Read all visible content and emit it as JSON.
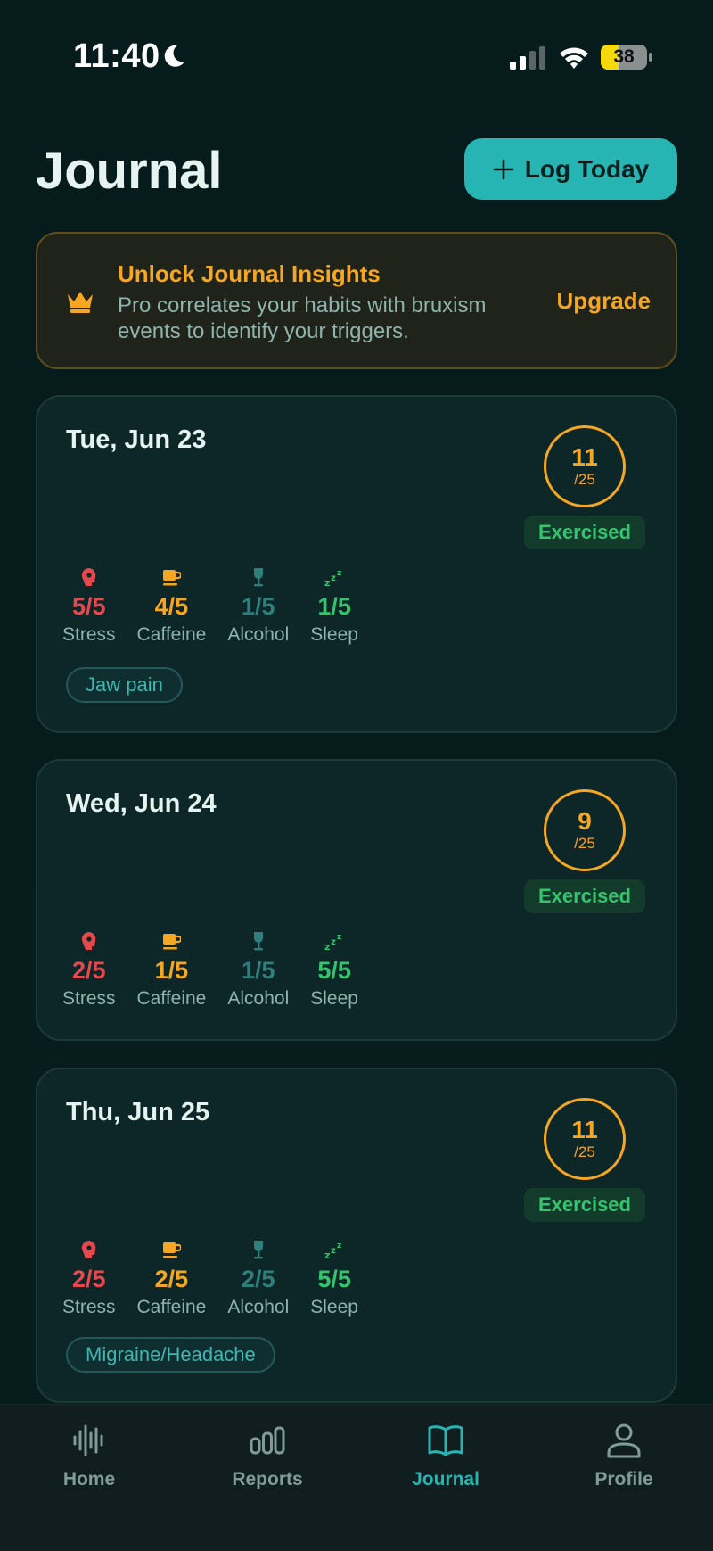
{
  "status_bar": {
    "time": "11:40",
    "battery_level": 38,
    "battery_text": "38"
  },
  "header": {
    "title": "Journal",
    "log_button_label": "Log Today"
  },
  "banner": {
    "title": "Unlock Journal Insights",
    "text": "Pro correlates your habits with bruxism events to identify your triggers.",
    "action_label": "Upgrade",
    "icon": "crown-icon"
  },
  "metric_labels": {
    "stress": "Stress",
    "caffeine": "Caffeine",
    "alcohol": "Alcohol",
    "sleep": "Sleep"
  },
  "entries": [
    {
      "date": "Tue, Jun 23",
      "score": "11",
      "score_max": "/25",
      "badge": "Exercised",
      "stress": "5/5",
      "caffeine": "4/5",
      "alcohol": "1/5",
      "sleep": "1/5",
      "tag": "Jaw pain"
    },
    {
      "date": "Wed, Jun 24",
      "score": "9",
      "score_max": "/25",
      "badge": "Exercised",
      "stress": "2/5",
      "caffeine": "1/5",
      "alcohol": "1/5",
      "sleep": "5/5"
    },
    {
      "date": "Thu, Jun 25",
      "score": "11",
      "score_max": "/25",
      "badge": "Exercised",
      "stress": "2/5",
      "caffeine": "2/5",
      "alcohol": "2/5",
      "sleep": "5/5",
      "tag": "Migraine/Headache"
    }
  ],
  "tabs": [
    {
      "label": "Home",
      "icon": "waveform-icon",
      "active": false
    },
    {
      "label": "Reports",
      "icon": "bar-chart-icon",
      "active": false
    },
    {
      "label": "Journal",
      "icon": "book-icon",
      "active": true
    },
    {
      "label": "Profile",
      "icon": "person-icon",
      "active": false
    }
  ],
  "colors": {
    "accent": "#26b5b2",
    "pro": "#f5a623",
    "stress": "#e5484d",
    "alcohol": "#2f7f7d",
    "sleep": "#35c46d",
    "background": "#061a1b",
    "card": "#0d2628"
  }
}
